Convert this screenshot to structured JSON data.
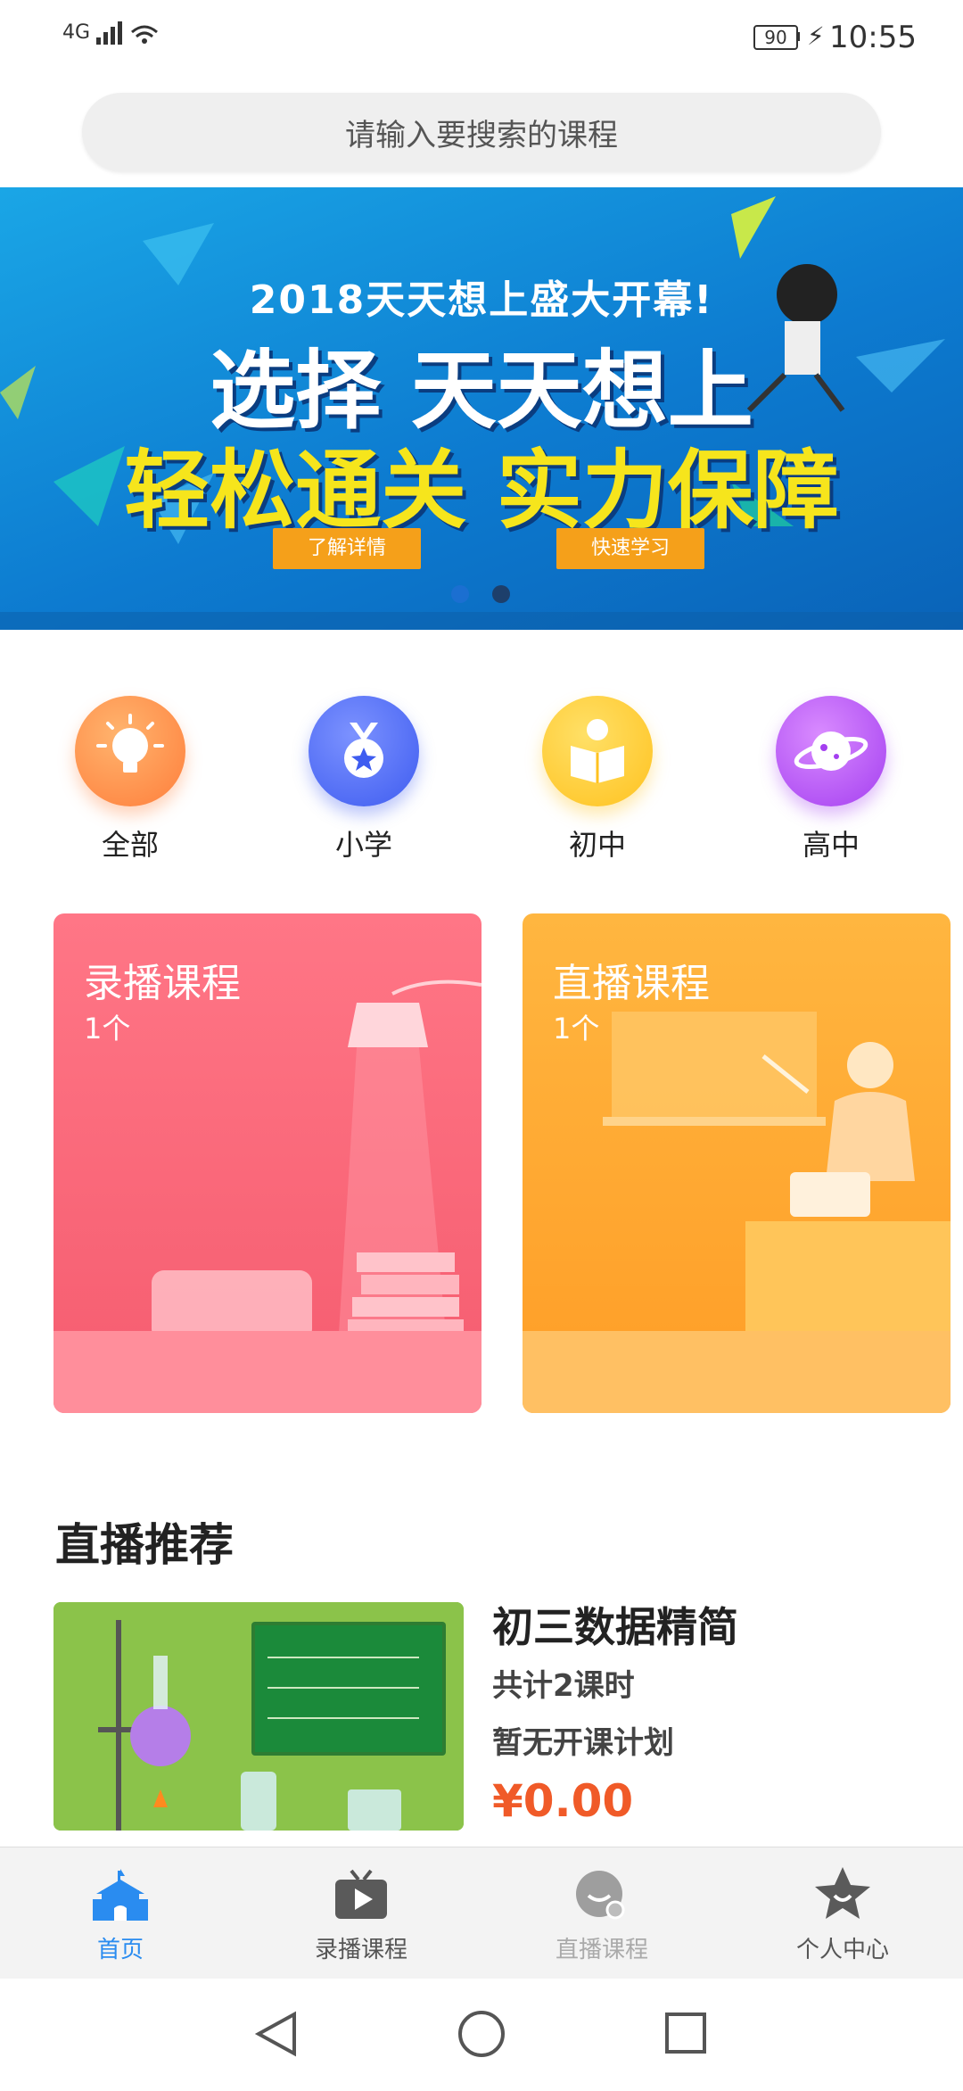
{
  "status_bar": {
    "network": "4G",
    "battery": "90",
    "time": "10:55"
  },
  "search": {
    "placeholder": "请输入要搜索的课程"
  },
  "banner": {
    "headline_small": "2018天天想上盛大开幕!",
    "line1": "选择 天天想上",
    "line2": "轻松通关 实力保障",
    "button_detail": "了解详情",
    "button_learn": "快速学习",
    "page_count": 2,
    "active_page": 1
  },
  "categories": [
    {
      "label": "全部",
      "icon": "bulb-icon"
    },
    {
      "label": "小学",
      "icon": "medal-icon"
    },
    {
      "label": "初中",
      "icon": "reading-icon"
    },
    {
      "label": "高中",
      "icon": "planet-icon"
    }
  ],
  "cards": {
    "recorded": {
      "title": "录播课程",
      "count": "1个"
    },
    "live": {
      "title": "直播课程",
      "count": "1个"
    }
  },
  "live_recommend": {
    "heading": "直播推荐",
    "course": {
      "title": "初三数据精简",
      "lessons": "共计2课时",
      "plan": "暂无开课计划",
      "price": "¥0.00"
    }
  },
  "tabs": [
    {
      "label": "首页",
      "icon": "home-icon",
      "active": true
    },
    {
      "label": "录播课程",
      "icon": "video-icon",
      "active": false
    },
    {
      "label": "直播课程",
      "icon": "live-icon",
      "active": false
    },
    {
      "label": "个人中心",
      "icon": "star-icon",
      "active": false
    }
  ],
  "colors": {
    "accent": "#2a8cf0",
    "price": "#f05a28",
    "recorded_card": "#f55c6f",
    "live_card": "#ff9d26"
  }
}
